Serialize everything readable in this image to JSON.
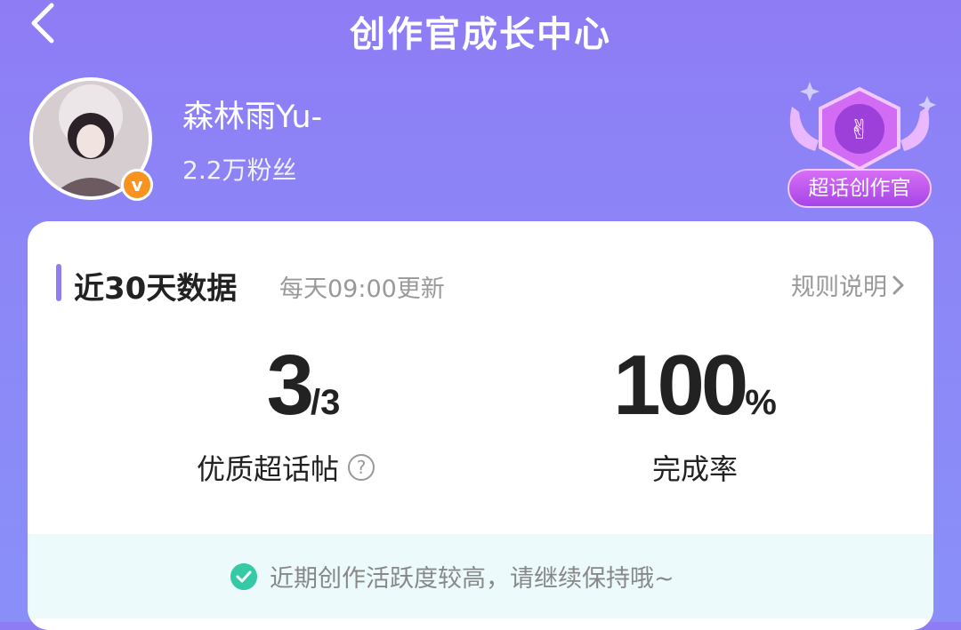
{
  "header": {
    "title": "创作官成长中心"
  },
  "profile": {
    "name": "森林雨Yu-",
    "followers": "2.2万粉丝",
    "verified_mark": "v"
  },
  "badge": {
    "label": "超话创作官"
  },
  "stats_card": {
    "title": "近30天数据",
    "update_note": "每天09:00更新",
    "rules_link": "规则说明",
    "metrics": [
      {
        "value": "3",
        "suffix": "/3",
        "label": "优质超话帖"
      },
      {
        "value": "100",
        "suffix": "%",
        "label": "完成率"
      }
    ],
    "tip": "近期创作活跃度较高，请继续保持哦~"
  },
  "colors": {
    "accent": "#8f7ef3",
    "badge": "#c35cf0",
    "verified": "#f7931e",
    "success": "#35c9a5"
  },
  "icons": [
    "back-arrow-icon",
    "verified-v-icon",
    "creator-badge-icon",
    "chevron-right-icon",
    "help-circle-icon",
    "check-circle-icon"
  ]
}
